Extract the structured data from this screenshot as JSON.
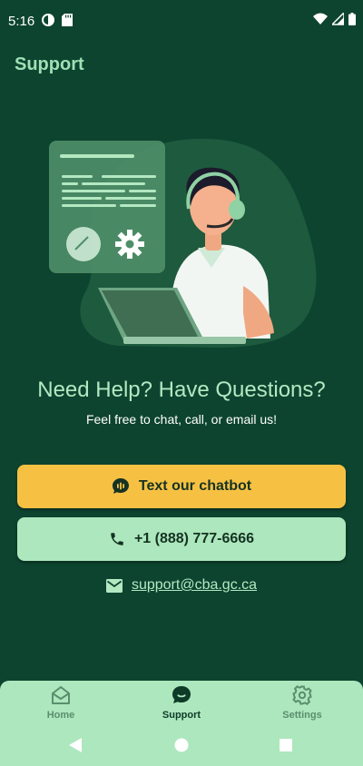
{
  "status_bar": {
    "time": "5:16",
    "left_icons": [
      "data-saver-icon",
      "sd-card-icon"
    ],
    "right_icons": [
      "wifi-icon",
      "signal-icon",
      "battery-icon"
    ]
  },
  "header": {
    "title": "Support"
  },
  "hero": {
    "illustration": "support-agent-illustration"
  },
  "main": {
    "headline": "Need Help? Have Questions?",
    "subtext": "Feel free to chat, call, or email us!"
  },
  "actions": {
    "chatbot": {
      "label": "Text our chatbot",
      "icon": "chat-icon",
      "color": "#f6c142"
    },
    "call": {
      "label": "+1 (888) 777-6666",
      "icon": "phone-icon",
      "color": "#ade7bd"
    },
    "email": {
      "label": "support@cba.gc.ca",
      "icon": "mail-icon"
    }
  },
  "bottom_nav": {
    "items": [
      {
        "label": "Home",
        "icon": "home-icon",
        "active": false
      },
      {
        "label": "Support",
        "icon": "support-chat-icon",
        "active": true
      },
      {
        "label": "Settings",
        "icon": "gear-icon",
        "active": false
      }
    ]
  },
  "system_nav": [
    "back-icon",
    "home-circle-icon",
    "recents-icon"
  ],
  "colors": {
    "background": "#0d4430",
    "accent_green": "#ade7bd",
    "accent_yellow": "#f6c142"
  }
}
